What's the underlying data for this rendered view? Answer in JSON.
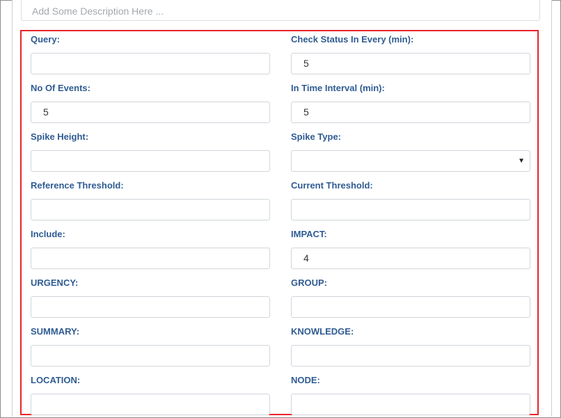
{
  "description": {
    "placeholder": "Add Some Description Here ..."
  },
  "fields": {
    "query": {
      "label": "Query:",
      "value": ""
    },
    "check_status": {
      "label": "Check Status In Every (min):",
      "value": "5"
    },
    "no_of_events": {
      "label": "No Of Events:",
      "value": "5"
    },
    "time_interval": {
      "label": "In Time Interval (min):",
      "value": "5"
    },
    "spike_height": {
      "label": "Spike Height:",
      "value": ""
    },
    "spike_type": {
      "label": "Spike Type:",
      "value": "",
      "caret": "▼"
    },
    "reference_threshold": {
      "label": "Reference Threshold:",
      "value": ""
    },
    "current_threshold": {
      "label": "Current Threshold:",
      "value": ""
    },
    "include": {
      "label": "Include:",
      "value": ""
    },
    "impact": {
      "label": "IMPACT:",
      "value": "4"
    },
    "urgency": {
      "label": "URGENCY:",
      "value": ""
    },
    "group": {
      "label": "GROUP:",
      "value": ""
    },
    "summary": {
      "label": "SUMMARY:",
      "value": ""
    },
    "knowledge": {
      "label": "KNOWLEDGE:",
      "value": ""
    },
    "location": {
      "label": "LOCATION:",
      "value": ""
    },
    "node": {
      "label": "NODE:",
      "value": ""
    }
  },
  "colors": {
    "label": "#2f5b92",
    "highlight_border": "#e8232a",
    "input_border": "#d0d5db",
    "placeholder": "#a3a8ae"
  }
}
